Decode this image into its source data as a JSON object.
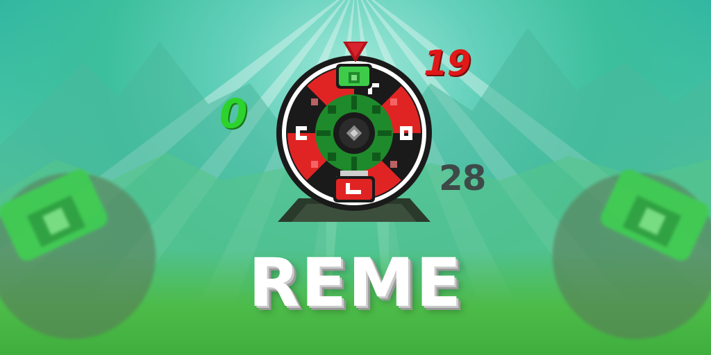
{
  "game": {
    "title": "REME",
    "numbers": {
      "green": "0",
      "red": "19",
      "grey": "28"
    }
  },
  "wheel": {
    "icons": [
      "roulette-wheel-icon",
      "pointer-arrow-icon"
    ],
    "colors": {
      "red": "#e02424",
      "green": "#1f8a2b",
      "dark_green": "#0f5a1a",
      "black": "#1a1a1a",
      "white": "#ffffff",
      "grey": "#8a8a8a",
      "pointer": "#b5121b",
      "base": "#2a3a2a"
    }
  },
  "background": {
    "colors": {
      "sky": "#63d0bb",
      "grass": "#3fae3d"
    }
  }
}
